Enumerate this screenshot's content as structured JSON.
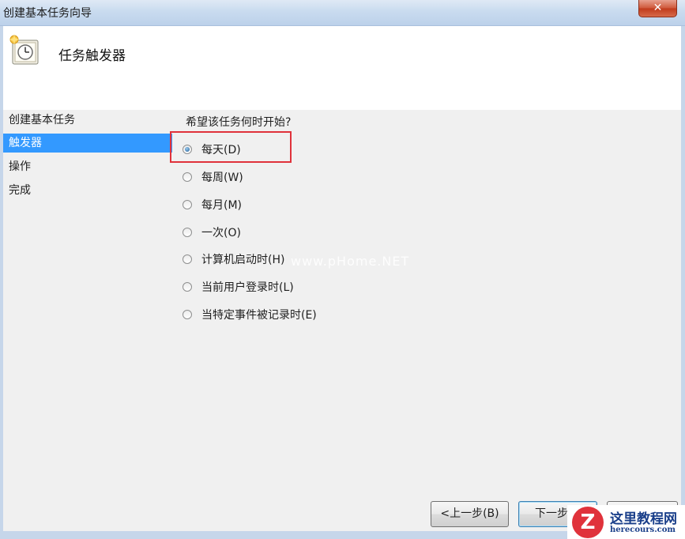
{
  "window": {
    "title": "创建基本任务向导",
    "close_glyph": "✕"
  },
  "header": {
    "title": "任务触发器",
    "icon": "task-scheduler-clock-icon"
  },
  "steps": [
    {
      "label": "创建基本任务"
    },
    {
      "label": "触发器"
    },
    {
      "label": "操作"
    },
    {
      "label": "完成"
    }
  ],
  "active_step": "触发器",
  "form": {
    "question": "希望该任务何时开始?",
    "options": [
      {
        "label": "每天(D)",
        "selected": true
      },
      {
        "label": "每周(W)",
        "selected": false
      },
      {
        "label": "每月(M)",
        "selected": false
      },
      {
        "label": "一次(O)",
        "selected": false
      },
      {
        "label": "计算机启动时(H)",
        "selected": false
      },
      {
        "label": "当前用户登录时(L)",
        "selected": false
      },
      {
        "label": "当特定事件被记录时(E)",
        "selected": false
      }
    ]
  },
  "watermark": "www.pHome.NET",
  "buttons": {
    "back": "<上一步(B)",
    "next": "下一步(N",
    "cancel": ""
  },
  "logo": {
    "mark": "Z",
    "name": "这里教程网",
    "site": "herecours.com"
  },
  "colors": {
    "accent": "#3399ff",
    "highlight": "#e0323b",
    "logo_text": "#1a3f8a"
  }
}
